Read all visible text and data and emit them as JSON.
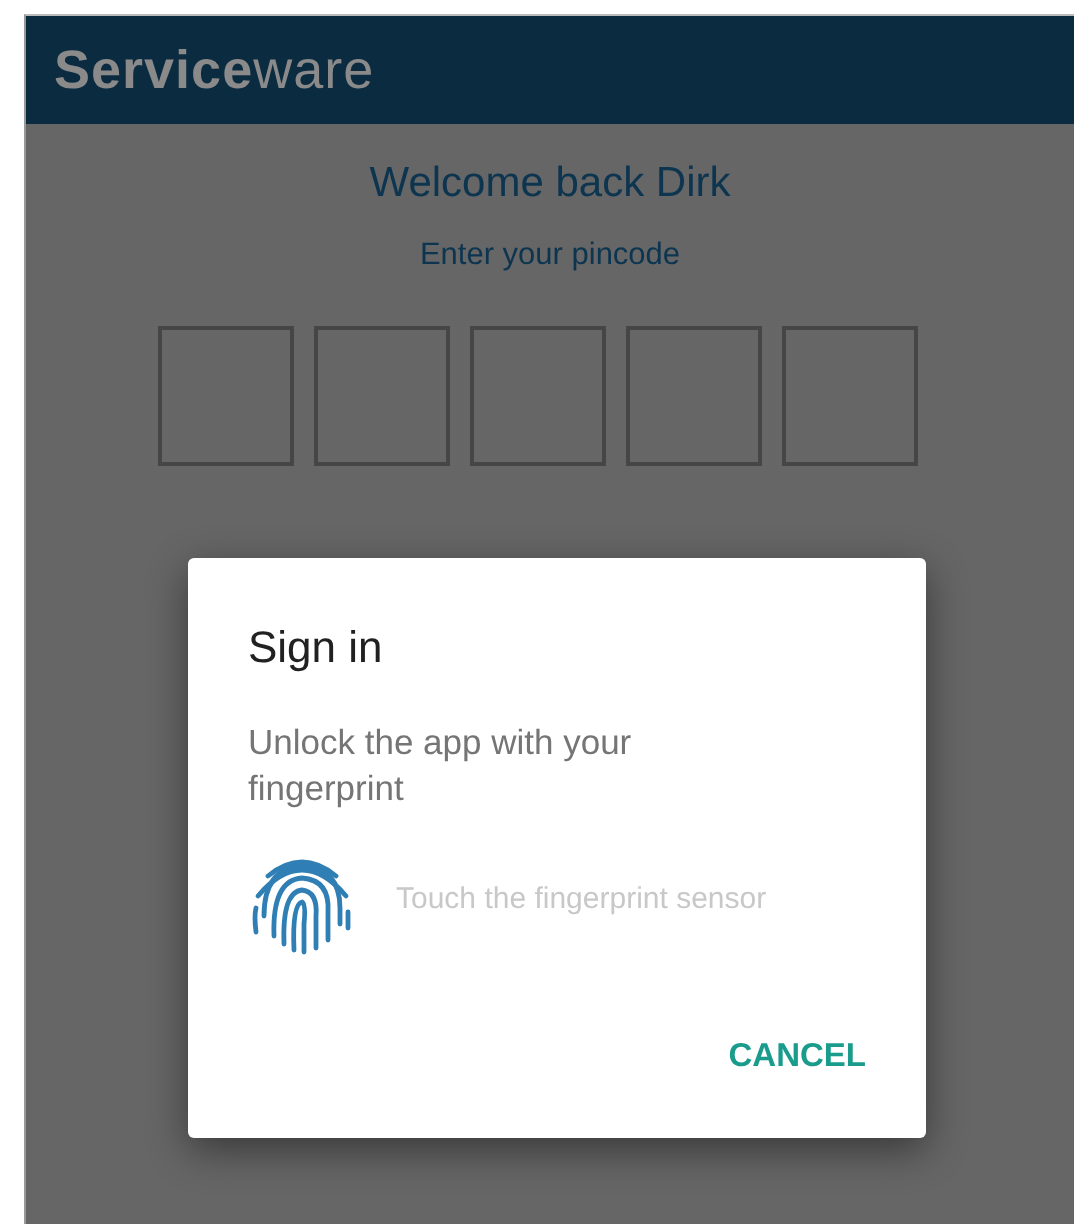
{
  "header": {
    "logo": "**Service**ware"
  },
  "welcome": "Welcome back Dirk",
  "prompt": "Enter your pincode",
  "pin_boxes": [
    {
      "filled": false
    },
    {
      "filled": false
    },
    {
      "filled": false
    },
    {
      "filled": false
    },
    {
      "filled": false
    }
  ],
  "dialog": {
    "title": "Sign in",
    "message": "Unlock the app with your fingerprint",
    "hint": "Touch the fingerprint sensor",
    "buttons": [
      "CANCEL"
    ]
  }
}
